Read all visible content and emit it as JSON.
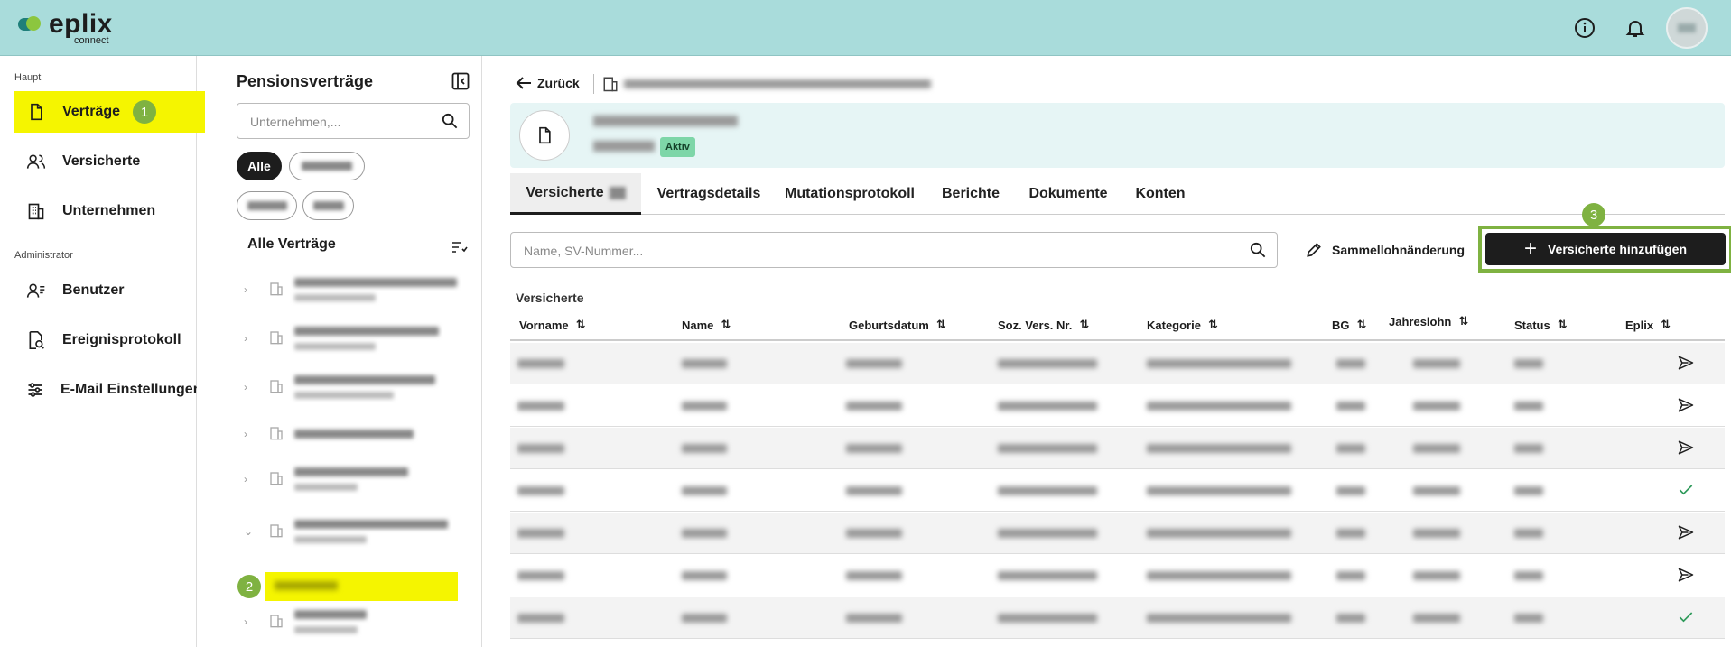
{
  "app": {
    "name": "eplix",
    "subtitle": "connect"
  },
  "header": {
    "icons": [
      "info-icon",
      "bell-icon",
      "avatar"
    ]
  },
  "sidebar": {
    "section_main": "Haupt",
    "section_admin": "Administrator",
    "items": [
      {
        "label": "Verträge",
        "icon": "document-icon",
        "badge": "1",
        "active": true
      },
      {
        "label": "Versicherte",
        "icon": "users-icon"
      },
      {
        "label": "Unternehmen",
        "icon": "building-icon"
      },
      {
        "label": "Benutzer",
        "icon": "user-settings-icon"
      },
      {
        "label": "Ereignisprotokoll",
        "icon": "log-search-icon"
      },
      {
        "label": "E-Mail Einstellungen",
        "icon": "sliders-icon"
      }
    ]
  },
  "panel": {
    "title": "Pensionsverträge",
    "search_placeholder": "Unternehmen,...",
    "chip_all": "Alle",
    "list_title": "Alle Verträge",
    "selected_badge": "2"
  },
  "main": {
    "back_label": "Zurück",
    "status_badge": "Aktiv",
    "tabs": [
      "Versicherte",
      "Vertragsdetails",
      "Mutationsprotokoll",
      "Berichte",
      "Dokumente",
      "Konten"
    ],
    "search_placeholder": "Name, SV-Nummer...",
    "sammel_label": "Sammellohnänderung",
    "add_button_label": "Versicherte hinzufügen",
    "add_badge": "3",
    "table_caption": "Versicherte",
    "columns": [
      "Vorname",
      "Name",
      "Geburtsdatum",
      "Soz. Vers. Nr.",
      "Kategorie",
      "BG",
      "Jahreslohn",
      "Status",
      "Eplix"
    ],
    "row_actions": [
      "send",
      "send",
      "send",
      "check",
      "send",
      "send",
      "check"
    ]
  },
  "colors": {
    "topbar": "#a9dcdb",
    "highlight": "#f5f500",
    "badge": "#7fb241",
    "accent_dark": "#1d1d1d",
    "status_active": "#7ed6a8"
  }
}
